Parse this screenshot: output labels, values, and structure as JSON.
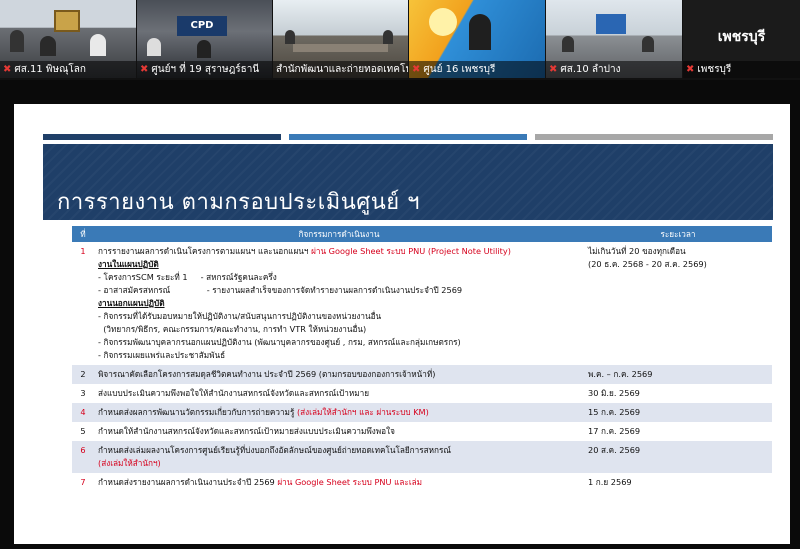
{
  "participants": [
    {
      "label": "ศส.11 พิษณุโลก",
      "muted": true
    },
    {
      "label": "ศูนย์ฯ ที่ 19 สุราษฎร์ธานี",
      "muted": true
    },
    {
      "label": "สำนักพัฒนาและถ่ายทอดเทคโน",
      "muted": false,
      "active": true
    },
    {
      "label": "ศูนย์ 16 เพชรบุรี",
      "muted": true
    },
    {
      "label": "ศส.10 ลำปาง",
      "muted": true
    },
    {
      "label": "เพชรบุรี",
      "big": "เพชรบุรี",
      "muted": true
    }
  ],
  "slide": {
    "title": "การรายงาน ตามกรอบประเมินศูนย์ ฯ",
    "bar_colors": [
      "#1f3f68",
      "#3a7ab7",
      "#a7a7a7"
    ],
    "table": {
      "headers": [
        "ที่",
        "กิจกรรมการดำเนินงาน",
        "ระยะเวลา"
      ],
      "row1": {
        "num": "1",
        "line1_a": "การรายงานผลการดำเนินโครงการตามแผนฯ และนอกแผนฯ ",
        "line1_b": "ผ่าน Google Sheet ระบบ PNU (Project Note Utility)",
        "h1": "งานในแผนปฏิบัติ",
        "a1": "- โครงการSCM ระยะที่ 1     - สหกรณ์รัฐคนละครึ่ง",
        "a2": "- อาสาสมัครสหกรณ์              - รายงานผลสำเร็จของการจัดทำรายงานผลการดำเนินงานประจำปี 2569",
        "h2": "งานนอกแผนปฏิบัติ",
        "b1": "- กิจกรรมที่ได้รับมอบหมายให้ปฏิบัติงาน/สนับสนุนการปฏิบัติงานของหน่วยงานอื่น",
        "b2": "  (วิทยากร/พิธีกร, คณะกรรมการ/คณะทำงาน, การทำ VTR ให้หน่วยงานอื่น)",
        "b3": "- กิจกรรมพัฒนาบุคลากรนอกแผนปฏิบัติงาน (พัฒนาบุคลากรของศูนย์ , กรม, สหกรณ์และกลุ่มเกษตรกร)",
        "b4": "- กิจกรรมเผยแพร่และประชาสัมพันธ์",
        "period1": "ไม่เกินวันที่ 20 ของทุกเดือน",
        "period2": "(20 ธ.ค. 2568 - 20 ส.ค. 2569)"
      },
      "rows": [
        {
          "num": "2",
          "text": "พิจารณาคัดเลือกโครงการสมดุลชีวิตคนทำงาน ประจำปี 2569 (ตามกรอบของกองการเจ้าหน้าที่)",
          "red": "",
          "period": "พ.ค. – ก.ค. 2569",
          "red_num": false
        },
        {
          "num": "3",
          "text": "ส่งแบบประเมินความพึงพอใจให้สำนักงานสหกรณ์จังหวัดและสหกรณ์เป้าหมาย",
          "red": "",
          "period": "30 มิ.ย. 2569",
          "red_num": false
        },
        {
          "num": "4",
          "text": "กำหนดส่งผลการพัฒนานวัตกรรมเกี่ยวกับการถ่ายความรู้ ",
          "red": "(ส่งเล่มให้สำนักฯ และ ผ่านระบบ KM)",
          "period": "15 ก.ค. 2569",
          "red_num": true
        },
        {
          "num": "5",
          "text": "กำหนดให้สำนักงานสหกรณ์จังหวัดและสหกรณ์เป้าหมายส่งแบบประเมินความพึงพอใจ",
          "red": "",
          "period": "17 ก.ค. 2569",
          "red_num": false
        },
        {
          "num": "6",
          "text": "กำหนดส่งเล่มผลงานโครงการศูนย์เรียนรู้ที่บ่งบอกถึงอัตลักษณ์ของศูนย์ถ่ายทอดเทคโนโลยีการสหกรณ์",
          "red": "(ส่งเล่มให้สำนักฯ)",
          "period": "20 ส.ค. 2569",
          "red_num": true
        },
        {
          "num": "7",
          "text": "กำหนดส่งรายงานผลการดำเนินงานประจำปี 2569 ",
          "red": "ผ่าน Google Sheet ระบบ PNU และเล่ม",
          "period": "1 ก.ย 2569",
          "red_num": true
        }
      ]
    }
  }
}
